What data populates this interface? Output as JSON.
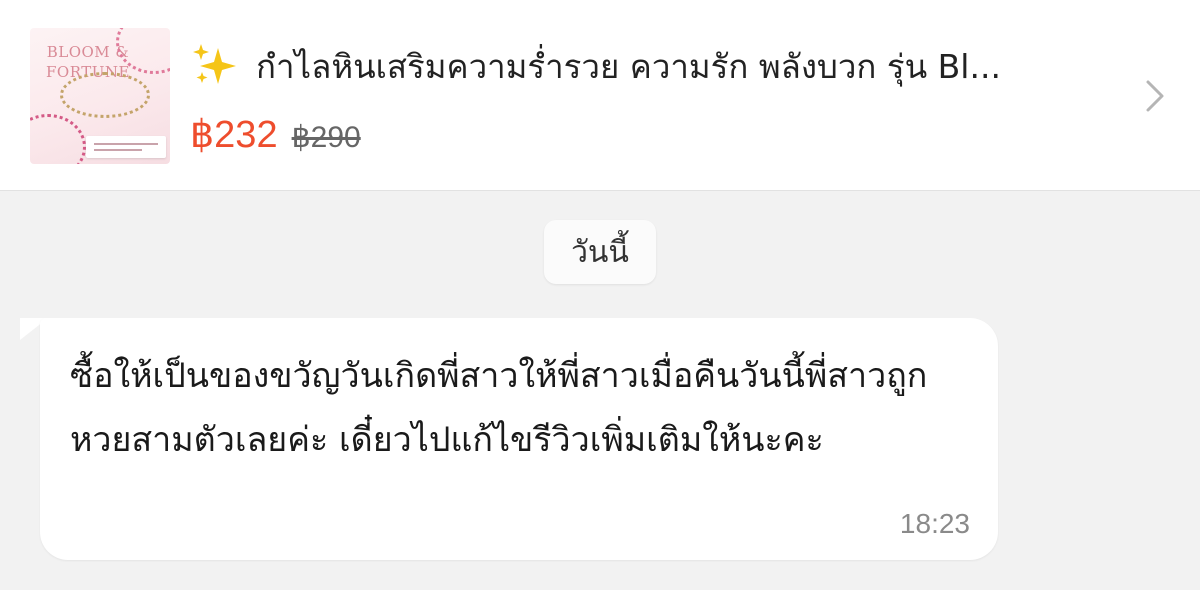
{
  "product": {
    "thumbnail_brand": "BLOOM & FORTUNE",
    "sparkle_icon": "sparkles-icon",
    "title": "กำไลหินเสริมความร่ำรวย ความรัก พลังบวก รุ่น Bl...",
    "price": "฿232",
    "original_price": "฿290",
    "chevron_icon": "chevron-right-icon",
    "price_color": "#ee4d2d"
  },
  "chat": {
    "date_label": "วันนี้",
    "messages": [
      {
        "text": "ซื้อให้เป็นของขวัญวันเกิดพี่สาวให้พี่สาวเมื่อคืนวันนี้พี่สาวถูกหวยสามตัวเลยค่ะ เดี๋ยวไปแก้ไขรีวิวเพิ่มเติมให้นะคะ",
        "time": "18:23"
      }
    ]
  }
}
